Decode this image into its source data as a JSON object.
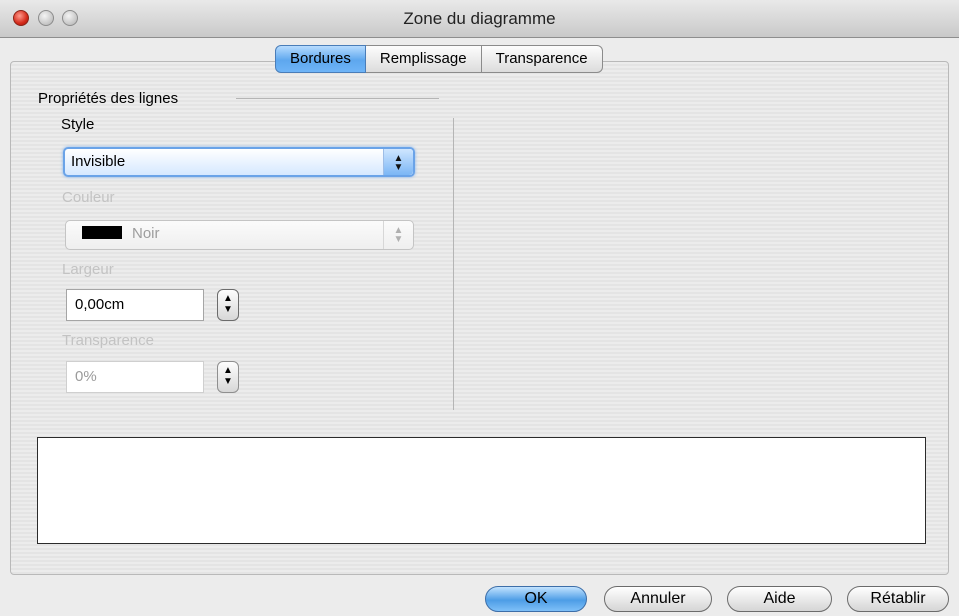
{
  "window": {
    "title": "Zone du diagramme"
  },
  "tabs": [
    {
      "label": "Bordures",
      "active": true
    },
    {
      "label": "Remplissage",
      "active": false
    },
    {
      "label": "Transparence",
      "active": false
    }
  ],
  "line_properties": {
    "section_title": "Propriétés des lignes",
    "style": {
      "label": "Style",
      "value": "Invisible"
    },
    "color": {
      "label": "Couleur",
      "value": "Noir",
      "swatch": "#000000",
      "disabled": true
    },
    "width": {
      "label": "Largeur",
      "value": "0,00cm",
      "disabled": true
    },
    "transparency": {
      "label": "Transparence",
      "value": "0%",
      "disabled": true
    }
  },
  "buttons": {
    "ok": "OK",
    "cancel": "Annuler",
    "help": "Aide",
    "reset": "Rétablir"
  },
  "colors": {
    "accent": "#5ea7ee",
    "disabled_text": "#c3c3c3"
  }
}
